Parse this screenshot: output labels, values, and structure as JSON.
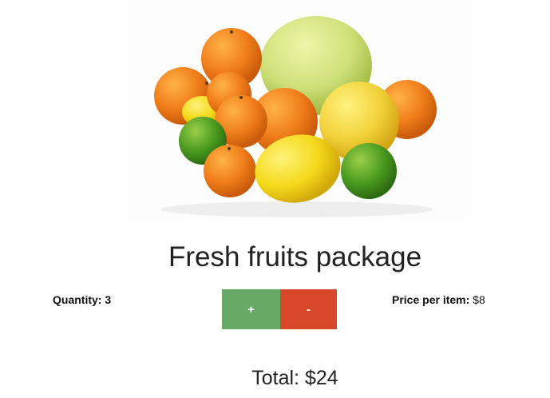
{
  "product": {
    "image_subject": "citrus fruits (oranges, lemons, limes, pomelo)",
    "title": "Fresh fruits package"
  },
  "quantity": {
    "label": "Quantity: 3",
    "value": 3
  },
  "buttons": {
    "increment_label": "+",
    "decrement_label": "-"
  },
  "price": {
    "label": "Price per item:",
    "value": "$8"
  },
  "total": {
    "text": "Total: $24"
  },
  "colors": {
    "increment_button": "#66aa66",
    "decrement_button": "#d9472b"
  }
}
